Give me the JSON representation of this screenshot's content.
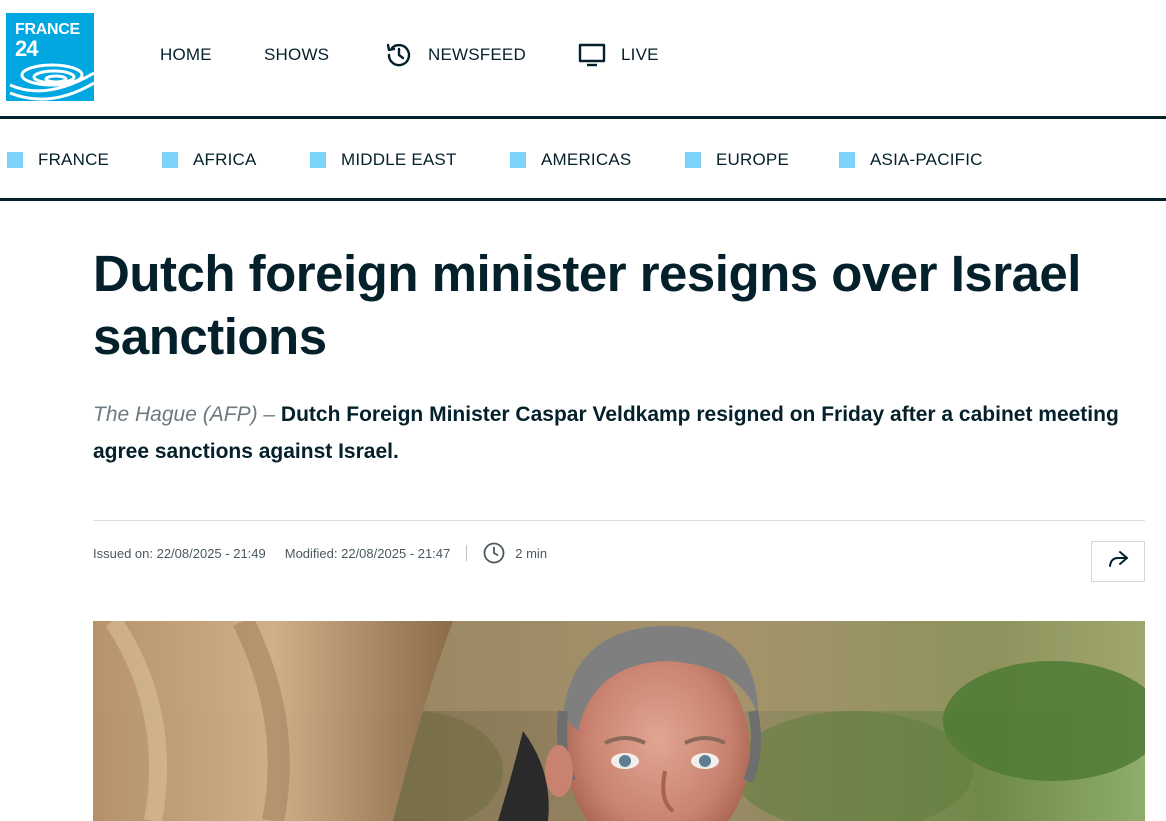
{
  "brand": {
    "logo_line1": "FRANCE",
    "logo_line2": "24",
    "accent": "#00a7e1"
  },
  "main_nav": [
    {
      "label": "HOME",
      "icon": ""
    },
    {
      "label": "SHOWS",
      "icon": ""
    },
    {
      "label": "NEWSFEED",
      "icon": "history-clock-icon"
    },
    {
      "label": "LIVE",
      "icon": "tv-monitor-icon"
    }
  ],
  "regions": [
    {
      "label": "FRANCE"
    },
    {
      "label": "AFRICA"
    },
    {
      "label": "MIDDLE EAST"
    },
    {
      "label": "AMERICAS"
    },
    {
      "label": "EUROPE"
    },
    {
      "label": "ASIA-PACIFIC"
    }
  ],
  "article": {
    "title_line1": "Dutch foreign minister resigns over Israel",
    "title_line2": "sanctions",
    "dateline": "The Hague (AFP) – ",
    "lede_line1": "Dutch Foreign Minister Caspar Veldkamp resigned on Friday after a cabinet meeting",
    "lede_line2": "agree sanctions against Israel.",
    "issued": "Issued on: 22/08/2025 - 21:49",
    "modified": "Modified: 22/08/2025 - 21:47",
    "read_time": "2 min"
  },
  "colors": {
    "dark": "#04202b",
    "region_square": "#7dd3f7"
  }
}
